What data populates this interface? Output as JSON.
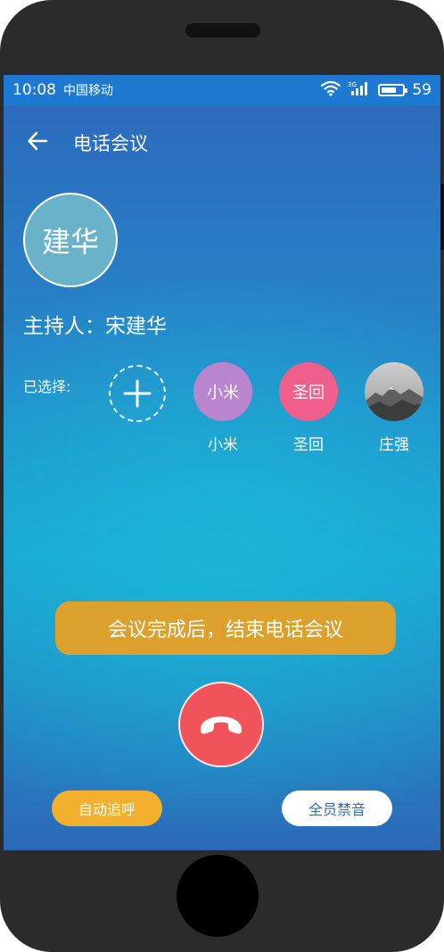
{
  "status_bar": {
    "time": "10:08",
    "carrier": "中国移动",
    "network": "3G",
    "battery_level": "59",
    "battery_fraction": 0.59
  },
  "header": {
    "title": "电话会议"
  },
  "host": {
    "avatar_text": "建华",
    "label": "主持人：宋建华"
  },
  "participants": {
    "label": "已选择:",
    "items": [
      {
        "avatar_text": "小米",
        "name": "小米",
        "color": "#b985cf"
      },
      {
        "avatar_text": "圣回",
        "name": "圣回",
        "color": "#f05e8c"
      },
      {
        "name": "庄强",
        "avatar_type": "landscape-photo"
      }
    ]
  },
  "notice": {
    "text": "会议完成后，结束电话会议"
  },
  "actions": {
    "auto_redial": "自动追呼",
    "mute_all": "全员禁音"
  },
  "colors": {
    "status_bar": "#1e7ad1",
    "notice": "#dca02c",
    "hangup": "#f0535a",
    "auto_redial": "#f2b02e",
    "mute_all_text": "#2e6eb6"
  }
}
